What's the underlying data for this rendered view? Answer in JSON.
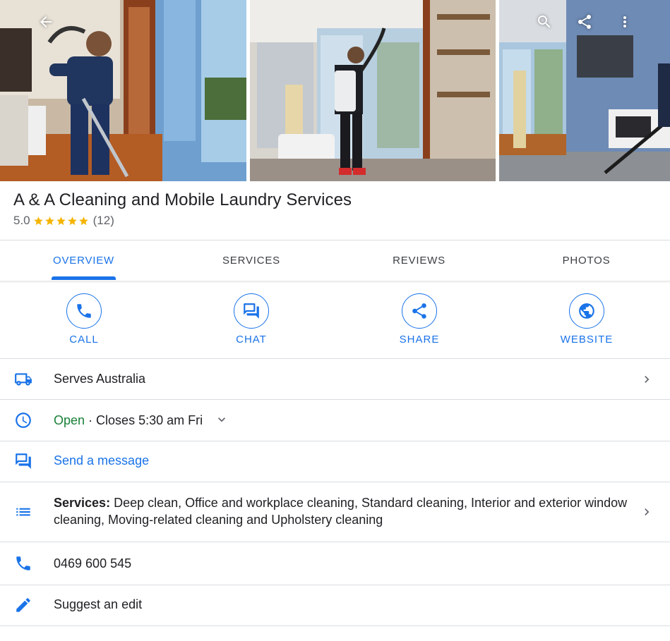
{
  "header": {
    "title": "A & A Cleaning and Mobile Laundry Services",
    "rating": "5.0",
    "star_count": 5,
    "review_count": "(12)"
  },
  "top_icons": [
    "back-arrow-icon",
    "search-icon",
    "share-icon",
    "more-vert-icon"
  ],
  "tabs": [
    {
      "label": "OVERVIEW",
      "active": true
    },
    {
      "label": "SERVICES",
      "active": false
    },
    {
      "label": "REVIEWS",
      "active": false
    },
    {
      "label": "PHOTOS",
      "active": false
    }
  ],
  "actions": [
    {
      "label": "CALL",
      "icon": "phone-icon"
    },
    {
      "label": "CHAT",
      "icon": "chat-icon"
    },
    {
      "label": "SHARE",
      "icon": "share-icon"
    },
    {
      "label": "WEBSITE",
      "icon": "globe-icon"
    }
  ],
  "info": {
    "serves": "Serves Australia",
    "hours_status": "Open",
    "hours_detail": " · Closes 5:30 am Fri",
    "message": "Send a message",
    "services_label": "Services:",
    "services_value": " Deep clean, Office and workplace cleaning, Standard cleaning, Interior and exterior window cleaning, Moving-related cleaning and Upholstery cleaning",
    "phone": "0469 600 545",
    "suggest_edit": "Suggest an edit"
  },
  "colors": {
    "accent": "#1a73e8",
    "open": "#188038",
    "star": "#f4b400",
    "text": "#202124",
    "divider": "#dadce0"
  }
}
